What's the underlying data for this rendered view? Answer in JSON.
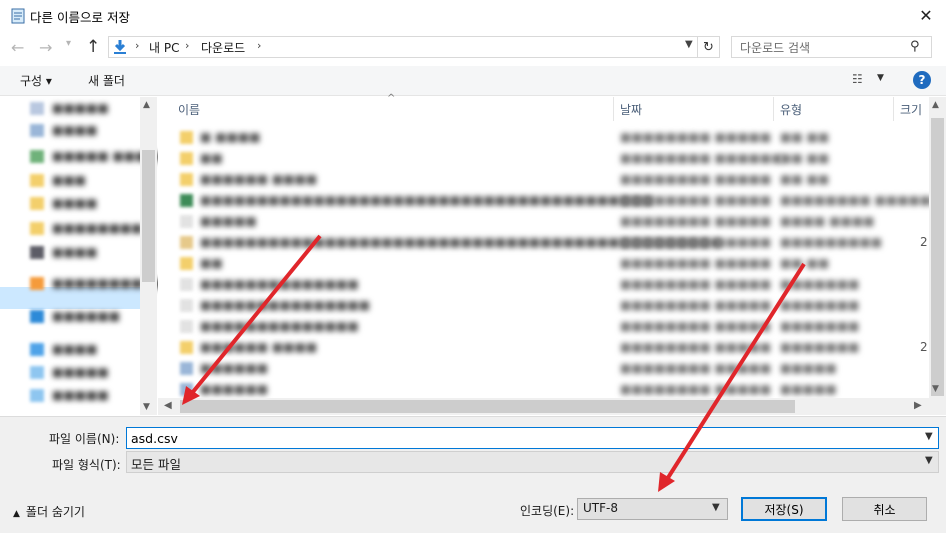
{
  "window": {
    "title": "다른 이름으로 저장",
    "close_icon": "✕"
  },
  "address": {
    "crumbs": [
      "내 PC",
      "다운로드"
    ],
    "separator": "›",
    "search_placeholder": "다운로드 검색"
  },
  "toolbar": {
    "organize_label": "구성 ▾",
    "new_folder_label": "새 폴더"
  },
  "columns": {
    "name": "이름",
    "date": "날짜",
    "type": "유형",
    "size": "크기"
  },
  "nav_items": [
    {
      "label": "■■■■■",
      "icon_color": "#b9c8e0"
    },
    {
      "label": "■■■■",
      "icon_color": "#9ab6d8"
    },
    {
      "label": "■■■■■ ■■■■■■■",
      "icon_color": "#6fb27a"
    },
    {
      "label": "■■■",
      "icon_color": "#f3cf6b"
    },
    {
      "label": "■■■■",
      "icon_color": "#f3cf6b"
    },
    {
      "label": "■■■■■■■■",
      "icon_color": "#f3cf6b"
    },
    {
      "label": "■■■■",
      "icon_color": "#5c5c66"
    },
    {
      "label": "■■■■■■■■■■■■",
      "icon_color": "#f59b3b"
    },
    {
      "label": "■■■■■■",
      "icon_color": "#2d8ad8"
    },
    {
      "label": "■■■■",
      "icon_color": "#4fa3e8"
    },
    {
      "label": "■■■■■",
      "icon_color": "#8ec6f0"
    },
    {
      "label": "■■■■■",
      "icon_color": "#8ec6f0"
    }
  ],
  "files": [
    {
      "name": "■ ■■■■",
      "date": "■■■■■■■■ ■■■■■",
      "type": "■■ ■■",
      "size": "",
      "icon_color": "#f3cf6b"
    },
    {
      "name": "■■",
      "date": "■■■■■■■■ ■■■■■■",
      "type": "■■ ■■",
      "size": "",
      "icon_color": "#f3cf6b"
    },
    {
      "name": "■■■■■■ ■■■■",
      "date": "■■■■■■■■ ■■■■■",
      "type": "■■ ■■",
      "size": "",
      "icon_color": "#f3cf6b"
    },
    {
      "name": "■■■■■■■■■■■■■■■■■■■■■■■■■■■■■■■■■■■■■■■■",
      "date": "■■■■■■■■ ■■■■■",
      "type": "■■■■■■■■ ■■■■■■■",
      "size": "",
      "icon_color": "#3d8b57"
    },
    {
      "name": "■■■■■",
      "date": "■■■■■■■■ ■■■■■",
      "type": "■■■■ ■■■■",
      "size": "",
      "icon_color": "#e2e2e2"
    },
    {
      "name": "■■■■■■■■■■■■■■■■■■■■■■■■■■■■■■■■■■■■■■■■■■■■■■",
      "date": "■■■■■■■■ ■■■■■",
      "type": "■■■■■■■■■",
      "size": "2",
      "icon_color": "#e6c98a"
    },
    {
      "name": "■■",
      "date": "■■■■■■■■ ■■■■■",
      "type": "■■ ■■",
      "size": "",
      "icon_color": "#f3cf6b"
    },
    {
      "name": "■■■■■■■■■■■■■■",
      "date": "■■■■■■■■ ■■■■■",
      "type": "■■■■■■■",
      "size": "",
      "icon_color": "#e2e2e2"
    },
    {
      "name": "■■■■■■■■■■■■■■■",
      "date": "■■■■■■■■ ■■■■■",
      "type": "■■■■■■■",
      "size": "",
      "icon_color": "#e2e2e2"
    },
    {
      "name": "■■■■■■■■■■■■■■",
      "date": "■■■■■■■■ ■■■■■",
      "type": "■■■■■■■",
      "size": "",
      "icon_color": "#e2e2e2"
    },
    {
      "name": "■■■■■■ ■■■■",
      "date": "■■■■■■■■ ■■■■■",
      "type": "■■■■■■■",
      "size": "2",
      "icon_color": "#f3cf6b"
    },
    {
      "name": "■■■■■■",
      "date": "■■■■■■■■ ■■■■■",
      "type": "■■■■■",
      "size": "",
      "icon_color": "#9ab6d8"
    },
    {
      "name": "■■■■■■",
      "date": "■■■■■■■■ ■■■■■",
      "type": "■■■■■",
      "size": "",
      "icon_color": "#9ab6d8"
    }
  ],
  "form": {
    "filename_label": "파일 이름(N):",
    "filename_value": "asd.csv",
    "filetype_label": "파일 형식(T):",
    "filetype_value": "모든 파일",
    "hide_folders_label": "폴더 숨기기",
    "encoding_label": "인코딩(E):",
    "encoding_value": "UTF-8",
    "save_label": "저장(S)",
    "cancel_label": "취소"
  },
  "colors": {
    "accent": "#0078d7",
    "annotation_arrow": "#e0262b",
    "help": "#1f6bbf"
  }
}
